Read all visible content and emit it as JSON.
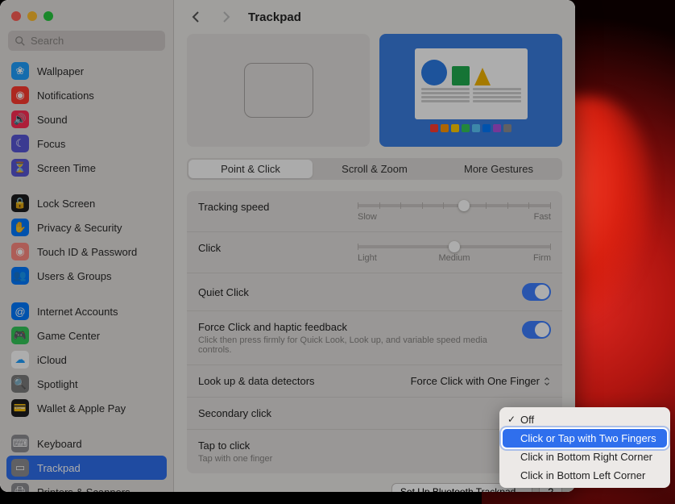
{
  "window": {
    "title": "Trackpad"
  },
  "search": {
    "placeholder": "Search"
  },
  "sidebar": {
    "groups": [
      [
        {
          "label": "Wallpaper",
          "bg": "#1fa0ff",
          "glyph": "❀"
        },
        {
          "label": "Notifications",
          "bg": "#ff3b30",
          "glyph": "◉"
        },
        {
          "label": "Sound",
          "bg": "#ff2d55",
          "glyph": "🔊"
        },
        {
          "label": "Focus",
          "bg": "#5856d6",
          "glyph": "☾"
        },
        {
          "label": "Screen Time",
          "bg": "#5856d6",
          "glyph": "⏳"
        }
      ],
      [
        {
          "label": "Lock Screen",
          "bg": "#1c1c1e",
          "glyph": "🔒"
        },
        {
          "label": "Privacy & Security",
          "bg": "#007aff",
          "glyph": "✋"
        },
        {
          "label": "Touch ID & Password",
          "bg": "#ff8a80",
          "glyph": "◉"
        },
        {
          "label": "Users & Groups",
          "bg": "#007aff",
          "glyph": "👥"
        }
      ],
      [
        {
          "label": "Internet Accounts",
          "bg": "#007aff",
          "glyph": "@"
        },
        {
          "label": "Game Center",
          "bg": "#34c759",
          "glyph": "🎮"
        },
        {
          "label": "iCloud",
          "bg": "#ffffff",
          "glyph": "☁",
          "fg": "#1fa0ff"
        },
        {
          "label": "Spotlight",
          "bg": "#7d7d7d",
          "glyph": "🔍"
        },
        {
          "label": "Wallet & Apple Pay",
          "bg": "#1c1c1e",
          "glyph": "💳"
        }
      ],
      [
        {
          "label": "Keyboard",
          "bg": "#8e8e93",
          "glyph": "⌨"
        },
        {
          "label": "Trackpad",
          "bg": "#8e8e93",
          "glyph": "▭",
          "selected": true
        },
        {
          "label": "Printers & Scanners",
          "bg": "#8e8e93",
          "glyph": "🖨"
        }
      ]
    ]
  },
  "tabs": [
    {
      "label": "Point & Click",
      "active": true
    },
    {
      "label": "Scroll & Zoom"
    },
    {
      "label": "More Gestures"
    }
  ],
  "rows": {
    "tracking": {
      "label": "Tracking speed",
      "min": "Slow",
      "max": "Fast",
      "pos": 55
    },
    "click": {
      "label": "Click",
      "min": "Light",
      "mid": "Medium",
      "max": "Firm",
      "pos": 50
    },
    "quiet": {
      "label": "Quiet Click",
      "on": true
    },
    "force": {
      "label": "Force Click and haptic feedback",
      "sub": "Click then press firmly for Quick Look, Look up, and variable speed media controls.",
      "on": true
    },
    "lookup": {
      "label": "Look up & data detectors",
      "value": "Force Click with One Finger"
    },
    "secondary": {
      "label": "Secondary click"
    },
    "tap": {
      "label": "Tap to click",
      "sub": "Tap with one finger"
    }
  },
  "footer": {
    "setup": "Set Up Bluetooth Trackpad...",
    "help": "?"
  },
  "popup": {
    "items": [
      {
        "label": "Off",
        "checked": true
      },
      {
        "label": "Click or Tap with Two Fingers",
        "selected": true
      },
      {
        "label": "Click in Bottom Right Corner"
      },
      {
        "label": "Click in Bottom Left Corner"
      }
    ]
  }
}
